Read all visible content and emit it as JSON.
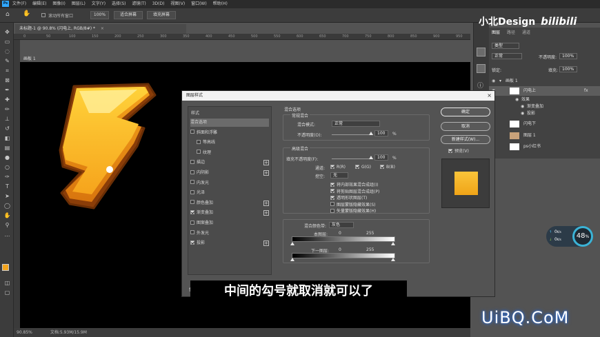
{
  "menubar": {
    "logo": "Ps",
    "items": [
      "文件(F)",
      "编辑(E)",
      "图像(I)",
      "图层(L)",
      "文字(Y)",
      "选择(S)",
      "滤镜(T)",
      "3D(D)",
      "视图(V)",
      "窗口(W)",
      "帮助(H)"
    ]
  },
  "options": {
    "scroll_all": "滚动所有窗口",
    "zoom": "100%",
    "fit_screen": "适合屏幕",
    "fill_screen": "填充屏幕"
  },
  "document": {
    "tab_title": "未标题-1 @ 90.8% (闪电上, RGB/8#) *",
    "artboard": "画板 1",
    "ruler_ticks": [
      "0",
      "50",
      "100",
      "150",
      "200",
      "250",
      "300",
      "350",
      "400",
      "450",
      "500",
      "550",
      "600",
      "650",
      "700",
      "750",
      "800",
      "850",
      "900",
      "950"
    ],
    "status_zoom": "90.85%",
    "status_doc": "文档:5.93M/15.9M"
  },
  "layers_panel": {
    "tabs": [
      "图层",
      "路径",
      "通道"
    ],
    "filter": "类型",
    "blend": "正常",
    "opacity_label": "不透明度:",
    "opacity": "100%",
    "fill_label": "填充:",
    "fill": "100%",
    "lock_label": "锁定:",
    "rows": [
      {
        "name": "画板 1"
      },
      {
        "name": "闪电上",
        "fx": "fx"
      },
      {
        "name": "效果"
      },
      {
        "name": "渐变叠加"
      },
      {
        "name": "投影"
      },
      {
        "name": "闪电下"
      },
      {
        "name": "图层 1"
      },
      {
        "name": "ps小红书"
      }
    ]
  },
  "dialog": {
    "title": "图层样式",
    "close": "×",
    "styles_header": "样式",
    "styles": [
      {
        "label": "混合选项",
        "checkbox": false,
        "checked": false,
        "plus": false,
        "selected": true
      },
      {
        "label": "斜面和浮雕",
        "checkbox": true,
        "checked": false,
        "plus": false
      },
      {
        "label": "等高线",
        "checkbox": true,
        "checked": false,
        "plus": false,
        "indent": true
      },
      {
        "label": "纹理",
        "checkbox": true,
        "checked": false,
        "plus": false,
        "indent": true
      },
      {
        "label": "描边",
        "checkbox": true,
        "checked": false,
        "plus": true
      },
      {
        "label": "内阴影",
        "checkbox": true,
        "checked": false,
        "plus": true
      },
      {
        "label": "内发光",
        "checkbox": true,
        "checked": false,
        "plus": false
      },
      {
        "label": "光泽",
        "checkbox": true,
        "checked": false,
        "plus": false
      },
      {
        "label": "颜色叠加",
        "checkbox": true,
        "checked": false,
        "plus": true
      },
      {
        "label": "渐变叠加",
        "checkbox": true,
        "checked": true,
        "plus": true
      },
      {
        "label": "图案叠加",
        "checkbox": true,
        "checked": false,
        "plus": false
      },
      {
        "label": "外发光",
        "checkbox": true,
        "checked": false,
        "plus": false
      },
      {
        "label": "投影",
        "checkbox": true,
        "checked": true,
        "plus": true
      }
    ],
    "blending": {
      "section": "混合选项",
      "general": "常规混合",
      "mode_label": "混合模式:",
      "mode": "正常",
      "opacity_label": "不透明度(O):",
      "opacity": "100",
      "unit": "%",
      "advanced": "高级混合",
      "fill_label": "填充不透明度(F):",
      "fill": "100",
      "channels_label": "通道:",
      "ch_r": "R(R)",
      "ch_g": "G(G)",
      "ch_b": "B(B)",
      "knockout_label": "挖空:",
      "knockout": "无",
      "opts": [
        {
          "label": "将内部效果混合成组(I)",
          "checked": true
        },
        {
          "label": "将剪贴图层混合成组(P)",
          "checked": true
        },
        {
          "label": "透明形状图层(T)",
          "checked": true
        },
        {
          "label": "图层蒙版隐藏效果(S)",
          "checked": false
        },
        {
          "label": "矢量蒙版隐藏效果(H)",
          "checked": false
        }
      ],
      "blend_if_label": "混合颜色带:",
      "blend_if": "灰色",
      "this_layer": "本图层:",
      "this_min": "0",
      "this_max": "255",
      "under_layer": "下一图层:",
      "under_min": "0",
      "under_max": "255"
    },
    "buttons": {
      "ok": "确定",
      "cancel": "取消",
      "new_style": "新建样式(W)...",
      "preview": "预览(V)"
    }
  },
  "subtitle": "中间的勾号就取消就可以了",
  "watermarks": {
    "top_text": "小北Design",
    "top_logo": "bilibili",
    "bottom": "UiBQ.CoM"
  },
  "perf_widget": {
    "percent": "48",
    "percent_suffix": "%",
    "up": "0",
    "down": "0",
    "unit": "K/s"
  }
}
